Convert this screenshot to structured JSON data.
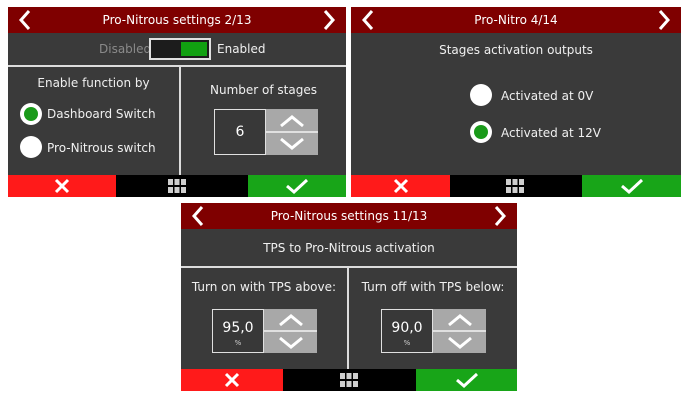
{
  "screen1": {
    "title": "Pro-Nitrous settings 2/13",
    "toggle": {
      "off_label": "Disabled",
      "on_label": "Enabled",
      "state": "on"
    },
    "enable_function": {
      "heading": "Enable function by",
      "options": [
        "Dashboard Switch",
        "Pro-Nitrous switch"
      ],
      "selected": 0
    },
    "stages": {
      "heading": "Number of stages",
      "value": "6"
    }
  },
  "screen2": {
    "title": "Pro-Nitro 4/14",
    "heading": "Stages activation outputs",
    "options": [
      "Activated at 0V",
      "Activated at 12V"
    ],
    "selected": 1
  },
  "screen3": {
    "title": "Pro-Nitrous settings 11/13",
    "heading": "TPS to Pro-Nitrous activation",
    "turn_on": {
      "label": "Turn on with TPS above:",
      "value": "95,0",
      "unit": "%"
    },
    "turn_off": {
      "label": "Turn off with TPS below:",
      "value": "90,0",
      "unit": "%"
    }
  },
  "colors": {
    "title_bar": "#7f0000",
    "panel": "#3a3a3a",
    "cancel": "#ff1a1a",
    "confirm": "#18a518",
    "radio_selected": "#1a9a1a"
  },
  "icons": {
    "prev": "chevron-left-icon",
    "next": "chevron-right-icon",
    "cancel": "x-icon",
    "menu": "grid-menu-icon",
    "confirm": "check-icon",
    "spin_up": "chevron-up-icon",
    "spin_down": "chevron-down-icon"
  }
}
